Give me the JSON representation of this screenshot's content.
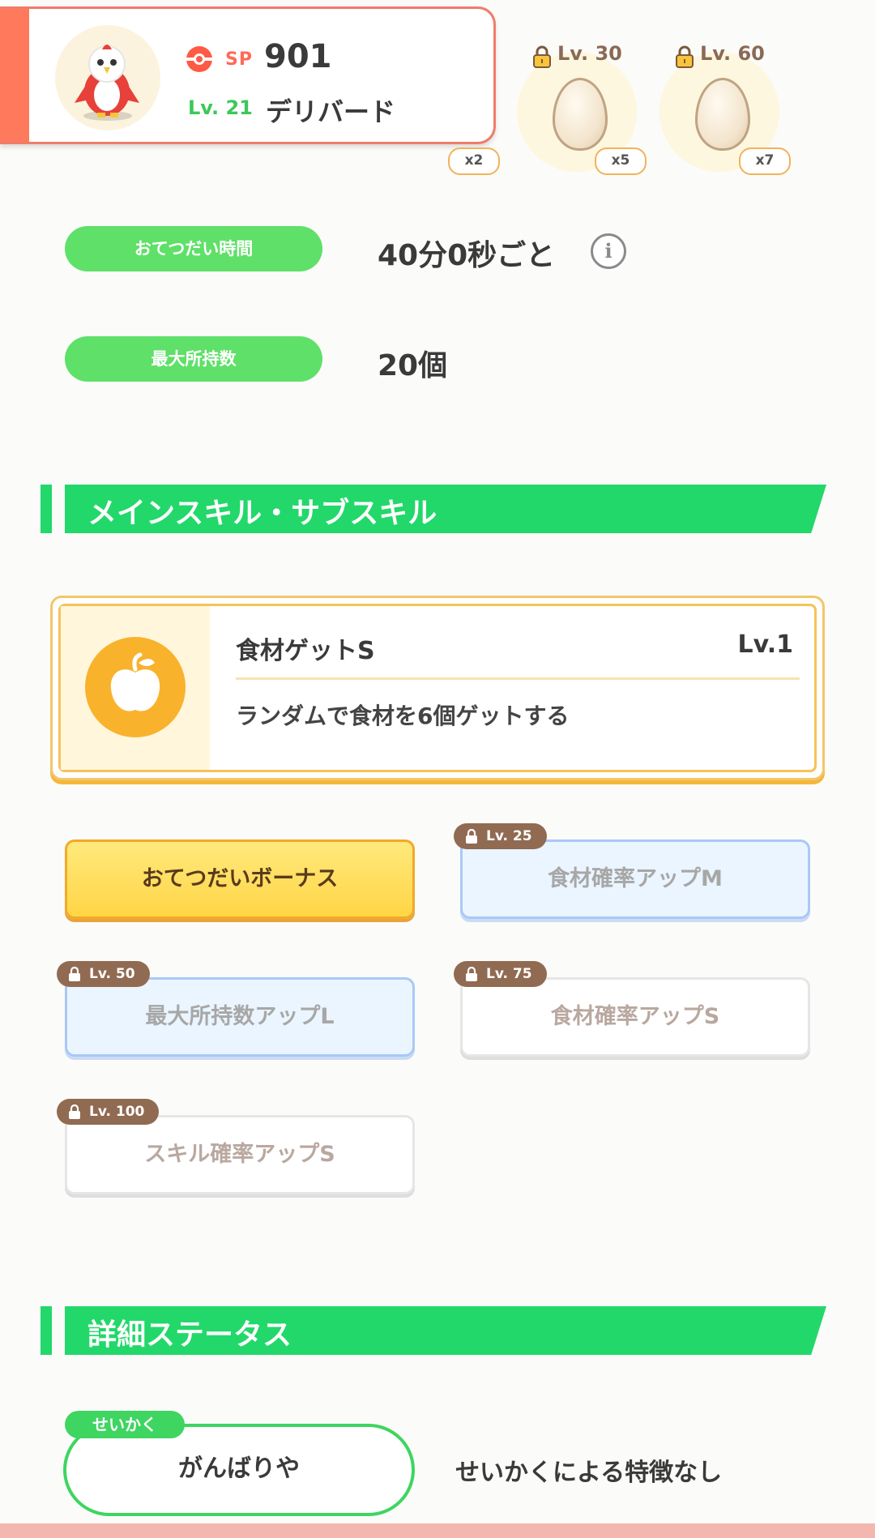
{
  "pokemon": {
    "sp_label": "SP",
    "sp_value": "901",
    "level_label": "Lv. 21",
    "name": "デリバード"
  },
  "eggs": [
    {
      "lock_label": "",
      "multiplier": "x2"
    },
    {
      "lock_label": "Lv. 30",
      "multiplier": "x5"
    },
    {
      "lock_label": "Lv. 60",
      "multiplier": "x7"
    }
  ],
  "info": {
    "help_time_label": "おてつだい時間",
    "help_time_value": "40分0秒ごと",
    "info_icon": "i",
    "max_carry_label": "最大所持数",
    "max_carry_value": "20個"
  },
  "sections": {
    "skills_title": "メインスキル・サブスキル",
    "status_title": "詳細ステータス"
  },
  "main_skill": {
    "name": "食材ゲットS",
    "level": "Lv.1",
    "description": "ランダムで食材を6個ゲットする",
    "icon": "apple-icon"
  },
  "sub_skills": [
    {
      "label": "おてつだいボーナス",
      "lock": "",
      "style": "gold"
    },
    {
      "label": "食材確率アップM",
      "lock": "Lv. 25",
      "style": "blue"
    },
    {
      "label": "最大所持数アップL",
      "lock": "Lv. 50",
      "style": "blue"
    },
    {
      "label": "食材確率アップS",
      "lock": "Lv. 75",
      "style": "white"
    },
    {
      "label": "スキル確率アップS",
      "lock": "Lv. 100",
      "style": "white"
    }
  ],
  "nature": {
    "tag": "せいかく",
    "value": "がんばりや",
    "effect": "せいかくによる特徴なし"
  },
  "colors": {
    "accent_green": "#22d86a",
    "pill_green": "#5fe068",
    "coral": "#ff7a5c",
    "gold": "#f9b22b",
    "lock_brown": "#916a52"
  }
}
